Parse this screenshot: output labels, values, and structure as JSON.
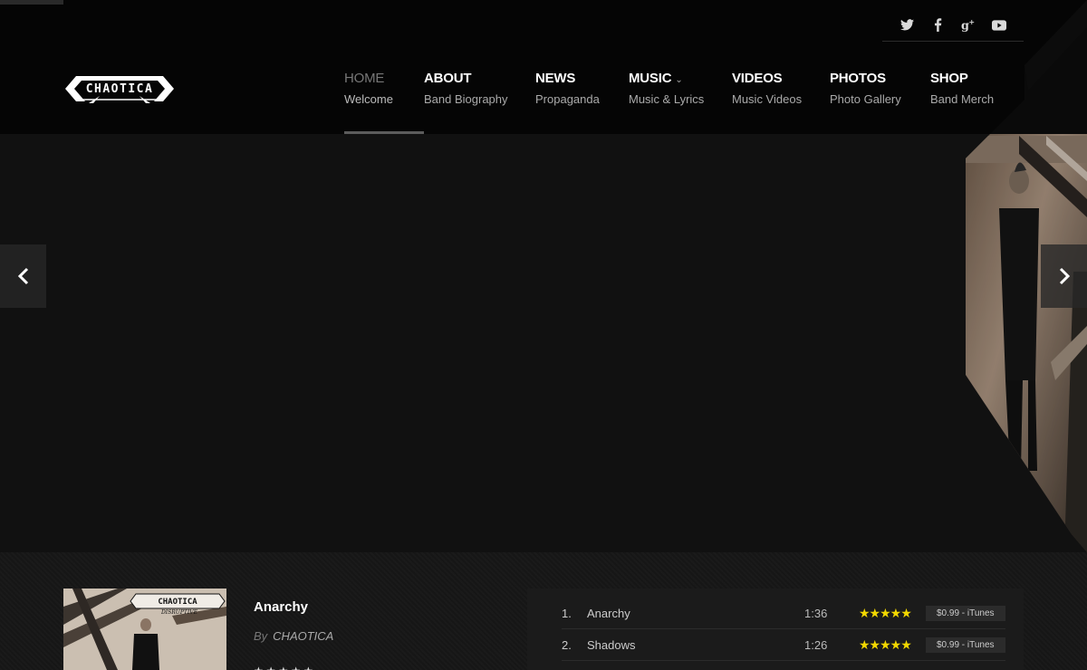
{
  "brand": {
    "logo_text": "CHAOTICA"
  },
  "social": [
    {
      "name": "twitter-icon"
    },
    {
      "name": "facebook-icon"
    },
    {
      "name": "google-plus-icon"
    },
    {
      "name": "youtube-icon"
    }
  ],
  "nav": {
    "items": [
      {
        "title": "HOME",
        "sub": "Welcome",
        "active": true
      },
      {
        "title": "ABOUT",
        "sub": "Band Biography"
      },
      {
        "title": "NEWS",
        "sub": "Propaganda"
      },
      {
        "title": "MUSIC",
        "sub": "Music & Lyrics",
        "caret": "⌄"
      },
      {
        "title": "VIDEOS",
        "sub": "Music Videos"
      },
      {
        "title": "PHOTOS",
        "sub": "Photo Gallery"
      },
      {
        "title": "SHOP",
        "sub": "Band Merch"
      }
    ]
  },
  "slider": {
    "prev_icon": "chevron-left-icon",
    "next_icon": "chevron-right-icon"
  },
  "album": {
    "art_title": "CHAOTICA",
    "art_subtitle": "DISRUPTIVE",
    "song_title": "Anarchy",
    "by_label": "By",
    "artist": "CHAOTICA",
    "stars": "★★★★★"
  },
  "tracks": [
    {
      "num": "1.",
      "name": "Anarchy",
      "duration": "1:36",
      "stars": "★★★★★",
      "price": "$0.99 - iTunes"
    },
    {
      "num": "2.",
      "name": "Shadows",
      "duration": "1:26",
      "stars": "★★★★★",
      "price": "$0.99 - iTunes"
    }
  ],
  "colors": {
    "star": "#f3d800",
    "header_bg": "#050505",
    "body_bg": "#121212"
  }
}
